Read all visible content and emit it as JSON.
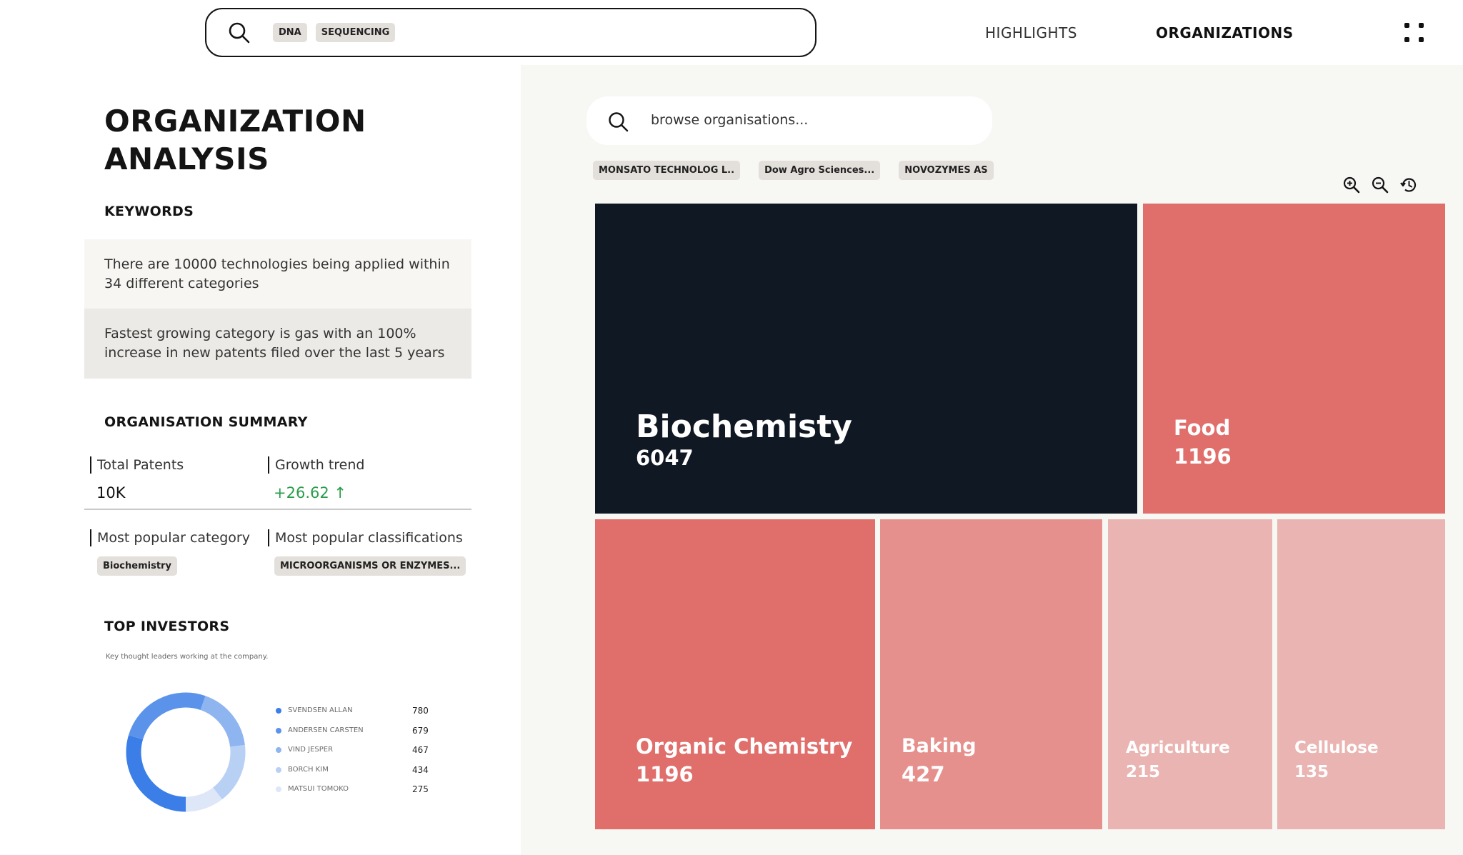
{
  "header": {
    "search_tags": [
      "DNA",
      "SEQUENCING"
    ],
    "nav": {
      "highlights": "HIGHLIGHTS",
      "organizations": "ORGANIZATIONS"
    }
  },
  "left": {
    "title_line1": "ORGANIZATION",
    "title_line2": "ANALYSIS",
    "keywords_title": "KEYWORDS",
    "keywords": [
      "There are 10000 technologies being applied within 34 different categories",
      "Fastest growing category is gas with an 100% increase in new patents filed over the last 5 years"
    ],
    "summary_title": "ORGANISATION SUMMARY",
    "summary": {
      "total_patents_label": "Total Patents",
      "total_patents_value": "10K",
      "growth_label": "Growth trend",
      "growth_value": "+26.62 ↑",
      "popular_category_label": "Most popular category",
      "popular_category_value": "Biochemistry",
      "popular_class_label": "Most popular classifications",
      "popular_class_value": "MICROORGANISMS OR ENZYMES..."
    },
    "investors_title": "TOP INVESTORS",
    "investors_subtitle": "Key thought leaders working at the company.",
    "investors": [
      {
        "name": "SVENDSEN ALLAN",
        "value": "780",
        "color": "#3b7ee8"
      },
      {
        "name": "ANDERSEN CARSTEN",
        "value": "679",
        "color": "#5b93ea"
      },
      {
        "name": "VIND JESPER",
        "value": "467",
        "color": "#8fb5f0"
      },
      {
        "name": "BORCH KIM",
        "value": "434",
        "color": "#b9d0f5"
      },
      {
        "name": "MATSUI TOMOKO",
        "value": "275",
        "color": "#dde7f8"
      }
    ]
  },
  "right": {
    "search_placeholder": "browse organisations...",
    "org_chips": [
      "MONSATO TECHNOLOG L..",
      "Dow Agro Sciences...",
      "NOVOZYMES AS"
    ],
    "tools": [
      "zoom-in-icon",
      "zoom-out-icon",
      "history-icon"
    ],
    "treemap": [
      {
        "label": "Biochemisty",
        "value": "6047",
        "color": "#101824"
      },
      {
        "label": "Food",
        "value": "1196",
        "color": "#e06e6a"
      },
      {
        "label": "Organic Chemistry",
        "value": "1196",
        "color": "#e06e6a"
      },
      {
        "label": "Baking",
        "value": "427",
        "color": "#e5908c"
      },
      {
        "label": "Agriculture",
        "value": "215",
        "color": "#e9b4b1"
      },
      {
        "label": "Cellulose",
        "value": "135",
        "color": "#e9b4b1"
      }
    ]
  }
}
